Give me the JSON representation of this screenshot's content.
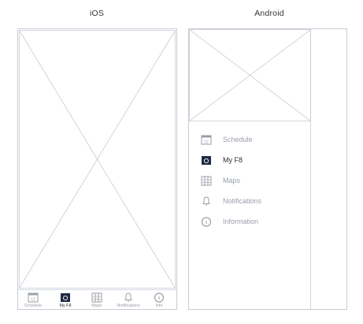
{
  "labels": {
    "ios": "iOS",
    "android": "Android"
  },
  "ios_tabs": [
    {
      "label": "Schedule",
      "icon": "calendar-icon",
      "active": false
    },
    {
      "label": "My F8",
      "icon": "my-f8-icon",
      "active": true
    },
    {
      "label": "Maps",
      "icon": "map-icon",
      "active": false
    },
    {
      "label": "Notifications",
      "icon": "bell-icon",
      "active": false
    },
    {
      "label": "Info",
      "icon": "info-icon",
      "active": false
    }
  ],
  "android_drawer": [
    {
      "label": "Schedule",
      "icon": "calendar-icon",
      "active": false
    },
    {
      "label": "My F8",
      "icon": "my-f8-icon",
      "active": true
    },
    {
      "label": "Maps",
      "icon": "map-icon",
      "active": false
    },
    {
      "label": "Notifications",
      "icon": "bell-icon",
      "active": false
    },
    {
      "label": "Information",
      "icon": "info-icon",
      "active": false
    }
  ],
  "colors": {
    "stroke": "#c9ccd6",
    "active": "#1f2a44",
    "inactive": "#9aa0a8"
  }
}
